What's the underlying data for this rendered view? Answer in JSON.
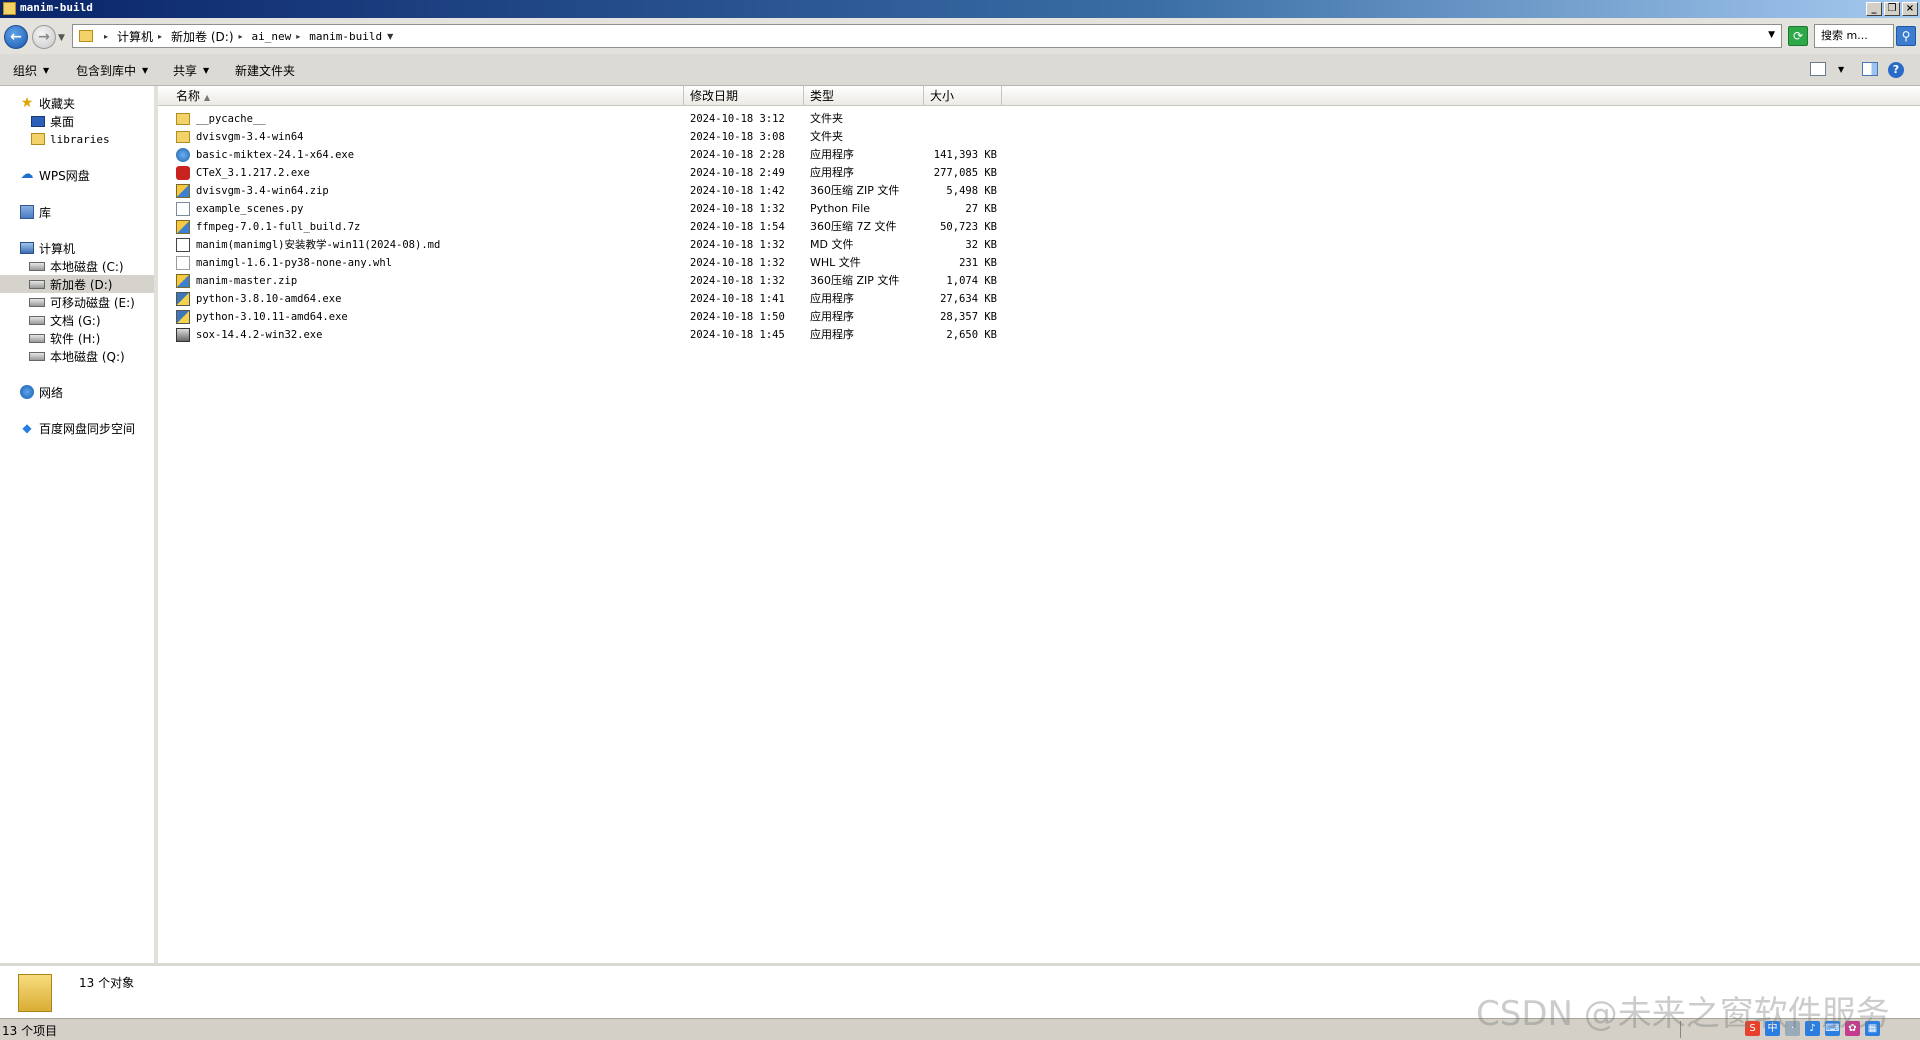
{
  "window": {
    "title": "manim-build"
  },
  "address": {
    "crumbs": [
      "计算机",
      "新加卷 (D:)",
      "ai_new",
      "manim-build"
    ],
    "search_placeholder": "搜索 m..."
  },
  "toolbar": {
    "organize": "组织",
    "include_library": "包含到库中",
    "share": "共享",
    "new_folder": "新建文件夹"
  },
  "sidebar": {
    "favorites": "收藏夹",
    "desktop": "桌面",
    "libraries": "libraries",
    "wps": "WPS网盘",
    "library": "库",
    "computer": "计算机",
    "drives": [
      {
        "label": "本地磁盘 (C:)"
      },
      {
        "label": "新加卷 (D:)",
        "selected": true
      },
      {
        "label": "可移动磁盘 (E:)"
      },
      {
        "label": "文档 (G:)"
      },
      {
        "label": "软件 (H:)"
      },
      {
        "label": "本地磁盘 (Q:)"
      }
    ],
    "network": "网络",
    "baidu": "百度网盘同步空间"
  },
  "columns": {
    "name": "名称",
    "date": "修改日期",
    "type": "类型",
    "size": "大小"
  },
  "files": [
    {
      "name": "__pycache__",
      "date": "2024-10-18 3:12",
      "type": "文件夹",
      "size": "",
      "icon": "folder-icon"
    },
    {
      "name": "dvisvgm-3.4-win64",
      "date": "2024-10-18 3:08",
      "type": "文件夹",
      "size": "",
      "icon": "folder-icon"
    },
    {
      "name": "basic-miktex-24.1-x64.exe",
      "date": "2024-10-18 2:28",
      "type": "应用程序",
      "size": "141,393 KB",
      "icon": "miktex-exe-icon"
    },
    {
      "name": "CTeX_3.1.217.2.exe",
      "date": "2024-10-18 2:49",
      "type": "应用程序",
      "size": "277,085 KB",
      "icon": "ctex-exe-icon"
    },
    {
      "name": "dvisvgm-3.4-win64.zip",
      "date": "2024-10-18 1:42",
      "type": "360压缩 ZIP 文件",
      "size": "5,498 KB",
      "icon": "zip-icon"
    },
    {
      "name": "example_scenes.py",
      "date": "2024-10-18 1:32",
      "type": "Python File",
      "size": "27 KB",
      "icon": "python-file-icon"
    },
    {
      "name": "ffmpeg-7.0.1-full_build.7z",
      "date": "2024-10-18 1:54",
      "type": "360压缩 7Z 文件",
      "size": "50,723 KB",
      "icon": "zip-icon"
    },
    {
      "name": "manim(manimgl)安装教学-win11(2024-08).md",
      "date": "2024-10-18 1:32",
      "type": "MD 文件",
      "size": "32 KB",
      "icon": "md-file-icon"
    },
    {
      "name": "manimgl-1.6.1-py38-none-any.whl",
      "date": "2024-10-18 1:32",
      "type": "WHL 文件",
      "size": "231 KB",
      "icon": "whl-file-icon"
    },
    {
      "name": "manim-master.zip",
      "date": "2024-10-18 1:32",
      "type": "360压缩 ZIP 文件",
      "size": "1,074 KB",
      "icon": "zip-icon"
    },
    {
      "name": "python-3.8.10-amd64.exe",
      "date": "2024-10-18 1:41",
      "type": "应用程序",
      "size": "27,634 KB",
      "icon": "python-installer-icon"
    },
    {
      "name": "python-3.10.11-amd64.exe",
      "date": "2024-10-18 1:50",
      "type": "应用程序",
      "size": "28,357 KB",
      "icon": "python-installer-icon"
    },
    {
      "name": "sox-14.4.2-win32.exe",
      "date": "2024-10-18 1:45",
      "type": "应用程序",
      "size": "2,650 KB",
      "icon": "sox-exe-icon"
    }
  ],
  "details": {
    "count": "13 个对象"
  },
  "status": {
    "items": "13 个项目"
  },
  "watermark": "CSDN @未来之窗软件服务"
}
